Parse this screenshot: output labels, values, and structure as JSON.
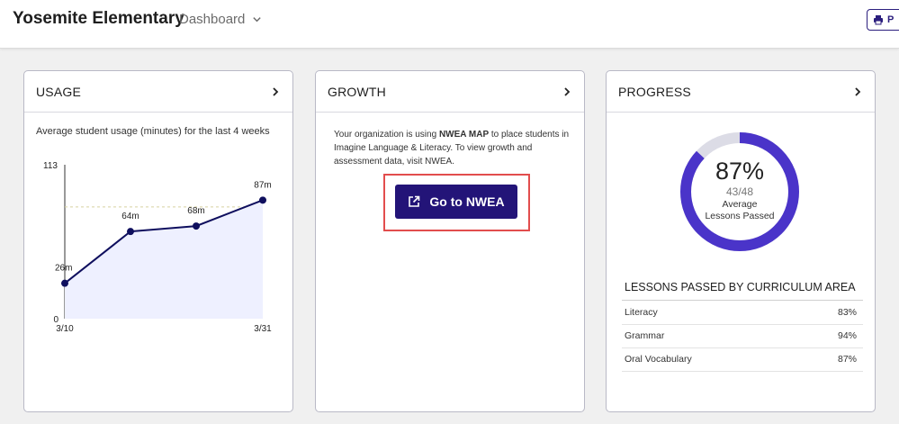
{
  "header": {
    "org_name": "Yosemite Elementary",
    "nav_label": "Dashboard",
    "print_label": "P"
  },
  "usage": {
    "title": "USAGE",
    "subtitle": "Average student usage (minutes) for the last 4 weeks"
  },
  "growth": {
    "title": "GROWTH",
    "text_prefix": "Your organization is using ",
    "text_bold": "NWEA MAP",
    "text_suffix": " to place students in Imagine Language & Literacy. To view growth and assessment data, visit NWEA.",
    "button_label": "Go to NWEA"
  },
  "progress": {
    "title": "PROGRESS",
    "percent_label": "87%",
    "fraction_label": "43/48",
    "caption_line1": "Average",
    "caption_line2": "Lessons Passed",
    "percent_value": 0.87,
    "lessons_title": "LESSONS PASSED BY CURRICULUM AREA",
    "areas": [
      {
        "name": "Literacy",
        "percent": "83%"
      },
      {
        "name": "Grammar",
        "percent": "94%"
      },
      {
        "name": "Oral Vocabulary",
        "percent": "87%"
      }
    ]
  },
  "colors": {
    "brand": "#231478",
    "donut_fill": "#4a34c9",
    "donut_track": "#dcdce6",
    "highlight": "#e24d4d",
    "chart_line": "#0f0f5e",
    "chart_area": "#eef0ff"
  },
  "chart_data": {
    "type": "area",
    "x": [
      "3/10",
      "",
      "",
      "3/31"
    ],
    "values": [
      26,
      64,
      68,
      87
    ],
    "point_labels": [
      "26m",
      "64m",
      "68m",
      "87m"
    ],
    "ylim": [
      0,
      113
    ],
    "ytick_labels": [
      "0",
      "113"
    ],
    "reference_line": 82
  }
}
